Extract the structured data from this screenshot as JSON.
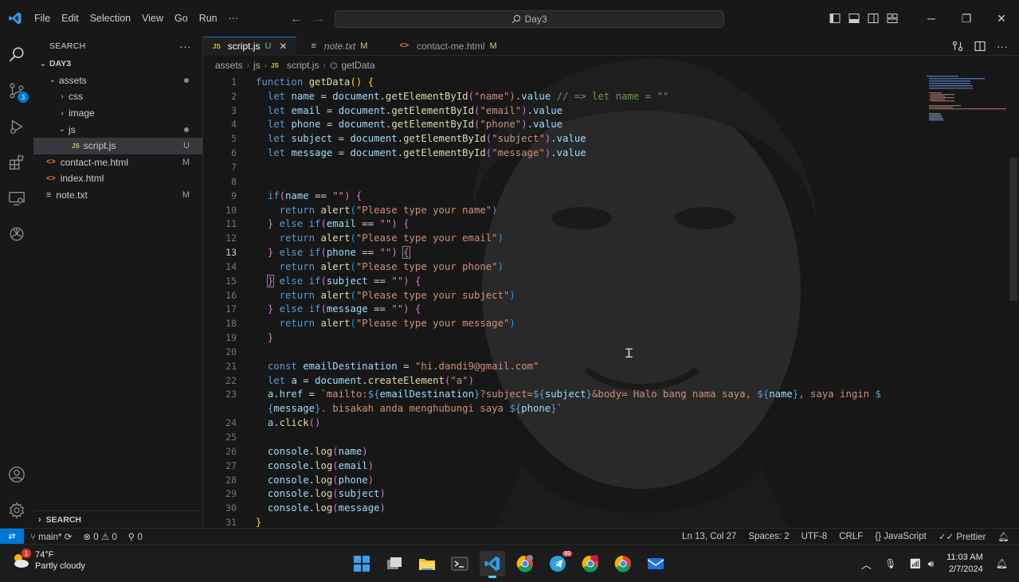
{
  "menu": [
    "File",
    "Edit",
    "Selection",
    "View",
    "Go",
    "Run",
    "···"
  ],
  "command_center": {
    "text": "Day3"
  },
  "activity": {
    "source_control_badge": "3"
  },
  "sidebar": {
    "header": "SEARCH",
    "more": "···",
    "root": "DAY3",
    "tree": [
      {
        "label": "assets",
        "indent": 1,
        "chev": "⌄",
        "status": "dot"
      },
      {
        "label": "css",
        "indent": 2,
        "chev": "›",
        "status": ""
      },
      {
        "label": "image",
        "indent": 2,
        "chev": "›",
        "status": ""
      },
      {
        "label": "js",
        "indent": 2,
        "chev": "⌄",
        "status": "dot"
      },
      {
        "label": "script.js",
        "indent": 3,
        "icon": "js",
        "status": "U",
        "selected": true
      },
      {
        "label": "contact-me.html",
        "indent": 1,
        "icon": "html",
        "status": "M"
      },
      {
        "label": "index.html",
        "indent": 1,
        "icon": "html",
        "status": ""
      },
      {
        "label": "note.txt",
        "indent": 1,
        "icon": "txt",
        "status": "M"
      }
    ],
    "footer": "SEARCH"
  },
  "tabs": [
    {
      "label": "script.js",
      "status": "U",
      "active": true
    },
    {
      "label": "note.txt",
      "status": "M",
      "active": false
    },
    {
      "label": "contact-me.html",
      "status": "M",
      "active": false
    }
  ],
  "breadcrumb": [
    "assets",
    "js",
    "script.js",
    "getData"
  ],
  "code": {
    "current_line": 13,
    "lines": [
      {
        "n": 1,
        "html": "<span class='kw'>function</span> <span class='fn'>getData</span><span class='br1'>()</span> <span class='br1'>{</span>"
      },
      {
        "n": 2,
        "html": "  <span class='kw'>let</span> <span class='var'>name</span> = <span class='var'>document</span>.<span class='fn'>getElementById</span><span class='br2'>(</span><span class='str'>\"name\"</span><span class='br2'>)</span>.<span class='var'>value</span> <span class='cm'>// =&gt; let name = \"\"</span>"
      },
      {
        "n": 3,
        "html": "  <span class='kw'>let</span> <span class='var'>email</span> = <span class='var'>document</span>.<span class='fn'>getElementById</span><span class='br2'>(</span><span class='str'>\"email\"</span><span class='br2'>)</span>.<span class='var'>value</span>"
      },
      {
        "n": 4,
        "html": "  <span class='kw'>let</span> <span class='var'>phone</span> = <span class='var'>document</span>.<span class='fn'>getElementById</span><span class='br2'>(</span><span class='str'>\"phone\"</span><span class='br2'>)</span>.<span class='var'>value</span>"
      },
      {
        "n": 5,
        "html": "  <span class='kw'>let</span> <span class='var'>subject</span> = <span class='var'>document</span>.<span class='fn'>getElementById</span><span class='br2'>(</span><span class='str'>\"subject\"</span><span class='br2'>)</span>.<span class='var'>value</span>"
      },
      {
        "n": 6,
        "html": "  <span class='kw'>let</span> <span class='var'>message</span> = <span class='var'>document</span>.<span class='fn'>getElementById</span><span class='br2'>(</span><span class='str'>\"message\"</span><span class='br2'>)</span>.<span class='var'>value</span>"
      },
      {
        "n": 7,
        "html": ""
      },
      {
        "n": 8,
        "html": ""
      },
      {
        "n": 9,
        "html": "  <span class='kw'>if</span><span class='br2'>(</span><span class='var'>name</span> == <span class='str'>\"\"</span><span class='br2'>)</span> <span class='br2'>{</span>"
      },
      {
        "n": 10,
        "html": "    <span class='kw'>return</span> <span class='fn'>alert</span><span class='br3'>(</span><span class='str'>\"Please type your name\"</span><span class='br3'>)</span>"
      },
      {
        "n": 11,
        "html": "  <span class='br2'>}</span> <span class='kw'>else</span> <span class='kw'>if</span><span class='br2'>(</span><span class='var'>email</span> == <span class='str'>\"\"</span><span class='br2'>)</span> <span class='br2'>{</span>"
      },
      {
        "n": 12,
        "html": "    <span class='kw'>return</span> <span class='fn'>alert</span><span class='br3'>(</span><span class='str'>\"Please type your email\"</span><span class='br3'>)</span>"
      },
      {
        "n": 13,
        "html": "  <span class='br2'>}</span> <span class='kw'>else</span> <span class='kw'>if</span><span class='br2'>(</span><span class='var'>phone</span> == <span class='str'>\"\"</span><span class='br2'>)</span> <span class='br2' style='outline:1px solid #888'>{</span>"
      },
      {
        "n": 14,
        "html": "    <span class='kw'>return</span> <span class='fn'>alert</span><span class='br3'>(</span><span class='str'>\"Please type your phone\"</span><span class='br3'>)</span>"
      },
      {
        "n": 15,
        "html": "  <span class='br2' style='outline:1px solid #888'>}</span> <span class='kw'>else</span> <span class='kw'>if</span><span class='br2'>(</span><span class='var'>subject</span> == <span class='str'>\"\"</span><span class='br2'>)</span> <span class='br2'>{</span>"
      },
      {
        "n": 16,
        "html": "    <span class='kw'>return</span> <span class='fn'>alert</span><span class='br3'>(</span><span class='str'>\"Please type your subject\"</span><span class='br3'>)</span>"
      },
      {
        "n": 17,
        "html": "  <span class='br2'>}</span> <span class='kw'>else</span> <span class='kw'>if</span><span class='br2'>(</span><span class='var'>message</span> == <span class='str'>\"\"</span><span class='br2'>)</span> <span class='br2'>{</span>"
      },
      {
        "n": 18,
        "html": "    <span class='kw'>return</span> <span class='fn'>alert</span><span class='br3'>(</span><span class='str'>\"Please type your message\"</span><span class='br3'>)</span>"
      },
      {
        "n": 19,
        "html": "  <span class='br2'>}</span>"
      },
      {
        "n": 20,
        "html": ""
      },
      {
        "n": 21,
        "html": "  <span class='kw'>const</span> <span class='var'>emailDestination</span> = <span class='str'>\"hi.dandi9@gmail.com\"</span>"
      },
      {
        "n": 22,
        "html": "  <span class='kw'>let</span> <span class='var'>a</span> = <span class='var'>document</span>.<span class='fn'>createElement</span><span class='br2'>(</span><span class='str'>\"a\"</span><span class='br2'>)</span>"
      },
      {
        "n": 23,
        "html": "  <span class='var'>a</span>.<span class='var'>href</span> = <span class='str'>`mailto:</span><span class='kw'>${</span><span class='var'>emailDestination</span><span class='kw'>}</span><span class='str'>?subject=</span><span class='kw'>${</span><span class='var'>subject</span><span class='kw'>}</span><span class='str'>&amp;body= Halo bang nama saya, </span><span class='kw'>${</span><span class='var'>name</span><span class='kw'>}</span><span class='str'>, saya ingin </span><span class='kw'>$</span>"
      },
      {
        "n": null,
        "html": "  <span class='kw'>{</span><span class='var'>message</span><span class='kw'>}</span><span class='str'>. bisakah anda menghubungi saya </span><span class='kw'>${</span><span class='var'>phone</span><span class='kw'>}</span><span class='str'>`</span>"
      },
      {
        "n": 24,
        "html": "  <span class='var'>a</span>.<span class='fn'>click</span><span class='br2'>()</span>"
      },
      {
        "n": 25,
        "html": ""
      },
      {
        "n": 26,
        "html": "  <span class='var'>console</span>.<span class='fn'>log</span><span class='br2'>(</span><span class='var'>name</span><span class='br2'>)</span>"
      },
      {
        "n": 27,
        "html": "  <span class='var'>console</span>.<span class='fn'>log</span><span class='br2'>(</span><span class='var'>email</span><span class='br2'>)</span>"
      },
      {
        "n": 28,
        "html": "  <span class='var'>console</span>.<span class='fn'>log</span><span class='br2'>(</span><span class='var'>phone</span><span class='br2'>)</span>"
      },
      {
        "n": 29,
        "html": "  <span class='var'>console</span>.<span class='fn'>log</span><span class='br2'>(</span><span class='var'>subject</span><span class='br2'>)</span>"
      },
      {
        "n": 30,
        "html": "  <span class='var'>console</span>.<span class='fn'>log</span><span class='br2'>(</span><span class='var'>message</span><span class='br2'>)</span>"
      },
      {
        "n": 31,
        "html": "<span class='br1'>}</span>"
      }
    ]
  },
  "statusbar": {
    "branch": "main*",
    "errors": "0",
    "warnings": "0",
    "ports": "0",
    "position": "Ln 13, Col 27",
    "spaces": "Spaces: 2",
    "encoding": "UTF-8",
    "eol": "CRLF",
    "language": "JavaScript",
    "formatter": "Prettier"
  },
  "taskbar": {
    "weather_temp": "74°F",
    "weather_desc": "Partly cloudy",
    "weather_badge": "1",
    "telegram_badge": "92",
    "time": "11:03 AM",
    "date": "2/7/2024"
  },
  "colors": {
    "accent": "#0078d4",
    "modified": "#e2c08d",
    "keyword": "#569cd6",
    "string": "#ce9178"
  }
}
